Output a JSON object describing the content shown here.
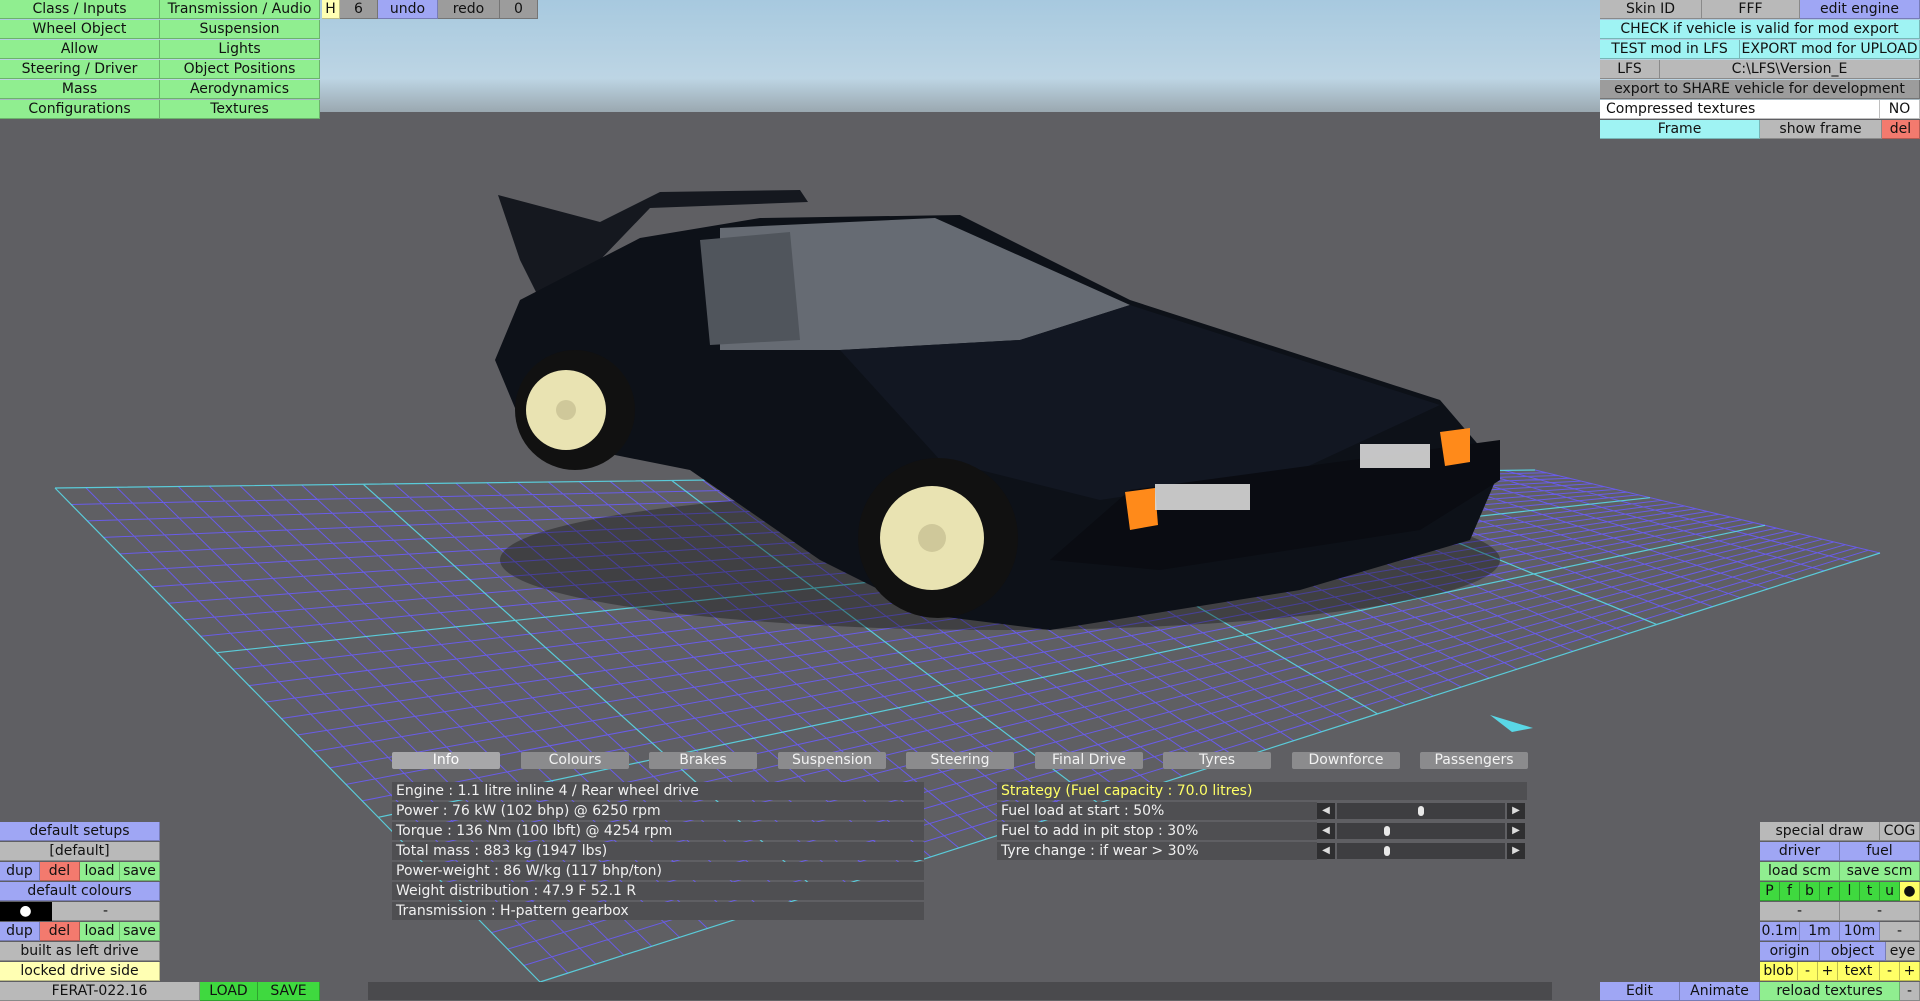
{
  "left_menu": [
    [
      "Class / Inputs",
      "Transmission / Audio"
    ],
    [
      "Wheel Object",
      "Suspension"
    ],
    [
      "Allow",
      "Lights"
    ],
    [
      "Steering / Driver",
      "Object Positions"
    ],
    [
      "Mass",
      "Aerodynamics"
    ],
    [
      "Configurations",
      "Textures"
    ]
  ],
  "top_toolbar": {
    "h": "H",
    "number": "6",
    "undo": "undo",
    "redo": "redo",
    "zero": "0"
  },
  "right_panel": {
    "skin_id": "Skin ID",
    "skin_value": "FFF",
    "edit_engine": "edit engine",
    "check": "CHECK if vehicle is valid for mod export",
    "test": "TEST mod in LFS",
    "export": "EXPORT mod for UPLOAD",
    "lfs": "LFS",
    "lfs_path": "C:\\LFS\\Version_E",
    "share": "export to SHARE vehicle for development",
    "compressed": "Compressed textures",
    "compressed_value": "NO",
    "frame": "Frame",
    "show_frame": "show frame",
    "del": "del"
  },
  "tabs": [
    "Info",
    "Colours",
    "Brakes",
    "Suspension",
    "Steering",
    "Final Drive",
    "Tyres",
    "Downforce",
    "Passengers"
  ],
  "info_lines": [
    "Engine : 1.1 litre inline 4 / Rear wheel drive",
    "Power : 76 kW (102 bhp) @ 6250 rpm",
    "Torque : 136 Nm (100 lbft) @ 4254 rpm",
    "Total mass : 883 kg (1947 lbs)",
    "Power-weight : 86 W/kg (117 bhp/ton)",
    "Weight distribution : 47.9 F  52.1 R",
    "Transmission : H-pattern gearbox"
  ],
  "strategy": {
    "title": "Strategy (Fuel capacity : 70.0 litres)",
    "rows": [
      {
        "label": "Fuel load at start : 50%",
        "value": 50
      },
      {
        "label": "Fuel to add in pit stop : 30%",
        "value": 30
      },
      {
        "label": "Tyre change : if wear > 30%",
        "value": 30
      }
    ]
  },
  "bottom_left": {
    "default_setups": "default setups",
    "default_name": "[default]",
    "dup": "dup",
    "del": "del",
    "load": "load",
    "save": "save",
    "default_colours": "default colours",
    "colour_swatch": "●",
    "colour_dash": "-",
    "built_left": "built as left drive",
    "locked_side": "locked drive side",
    "car_name": "FERAT-022.16",
    "load_btn": "LOAD",
    "save_btn": "SAVE"
  },
  "bottom_right": {
    "special_draw": "special draw",
    "cog": "COG",
    "driver": "driver",
    "fuel": "fuel",
    "load_scm": "load scm",
    "save_scm": "save scm",
    "letters": [
      "P",
      "f",
      "b",
      "r",
      "l",
      "t",
      "u"
    ],
    "dot": "●",
    "dash1": "-",
    "dash2": "-",
    "scales": [
      "0.1m",
      "1m",
      "10m",
      "-"
    ],
    "origin": "origin",
    "object": "object",
    "eye": "eye",
    "blob": "blob",
    "minus": "-",
    "plus": "+",
    "text": "text",
    "edit": "Edit",
    "animate": "Animate",
    "reload": "reload textures",
    "last_dash": "-"
  }
}
